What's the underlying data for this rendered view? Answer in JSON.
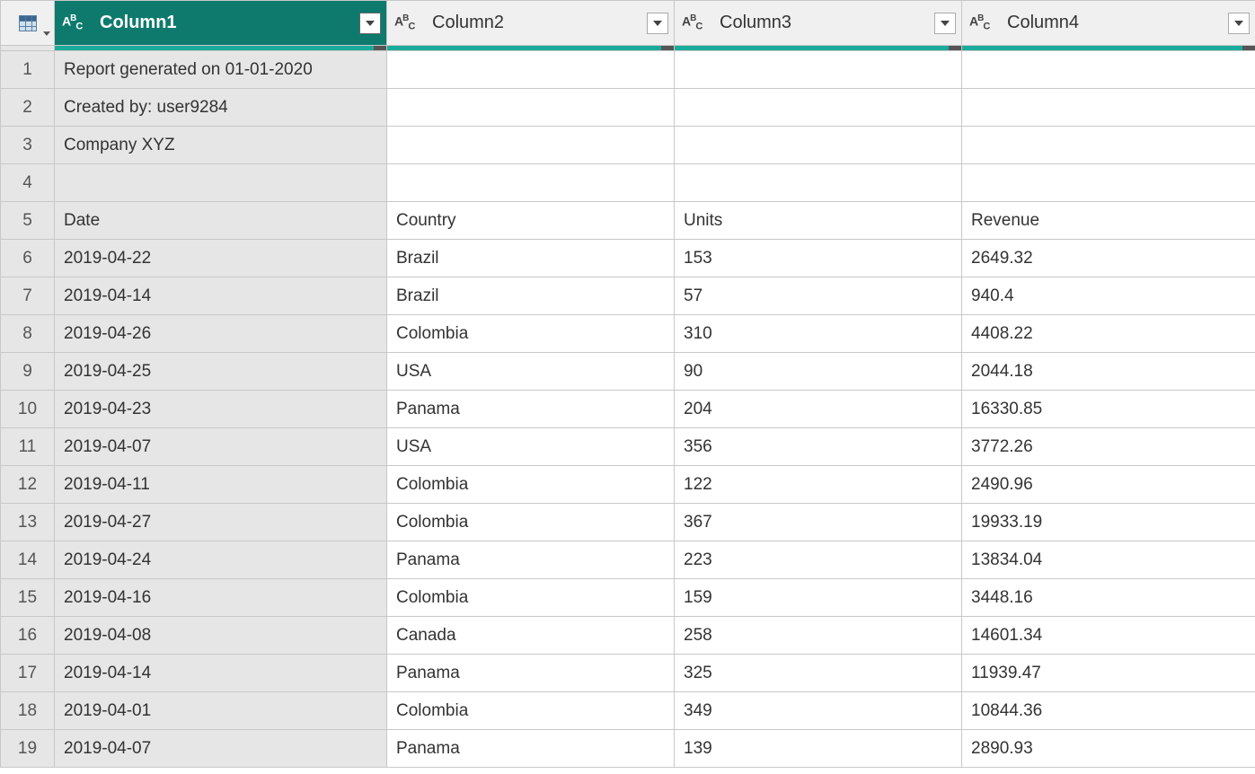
{
  "columns": [
    {
      "name": "Column1",
      "type_label": "ABC",
      "selected": true
    },
    {
      "name": "Column2",
      "type_label": "ABC",
      "selected": false
    },
    {
      "name": "Column3",
      "type_label": "ABC",
      "selected": false
    },
    {
      "name": "Column4",
      "type_label": "ABC",
      "selected": false
    }
  ],
  "row_numbers": [
    "1",
    "2",
    "3",
    "4",
    "5",
    "6",
    "7",
    "8",
    "9",
    "10",
    "11",
    "12",
    "13",
    "14",
    "15",
    "16",
    "17",
    "18",
    "19"
  ],
  "rows": [
    [
      "Report generated on 01-01-2020",
      "",
      "",
      ""
    ],
    [
      "Created by: user9284",
      "",
      "",
      ""
    ],
    [
      "Company XYZ",
      "",
      "",
      ""
    ],
    [
      "",
      "",
      "",
      ""
    ],
    [
      "Date",
      "Country",
      "Units",
      "Revenue"
    ],
    [
      "2019-04-22",
      "Brazil",
      "153",
      "2649.32"
    ],
    [
      "2019-04-14",
      "Brazil",
      "57",
      "940.4"
    ],
    [
      "2019-04-26",
      "Colombia",
      "310",
      "4408.22"
    ],
    [
      "2019-04-25",
      "USA",
      "90",
      "2044.18"
    ],
    [
      "2019-04-23",
      "Panama",
      "204",
      "16330.85"
    ],
    [
      "2019-04-07",
      "USA",
      "356",
      "3772.26"
    ],
    [
      "2019-04-11",
      "Colombia",
      "122",
      "2490.96"
    ],
    [
      "2019-04-27",
      "Colombia",
      "367",
      "19933.19"
    ],
    [
      "2019-04-24",
      "Panama",
      "223",
      "13834.04"
    ],
    [
      "2019-04-16",
      "Colombia",
      "159",
      "3448.16"
    ],
    [
      "2019-04-08",
      "Canada",
      "258",
      "14601.34"
    ],
    [
      "2019-04-14",
      "Panama",
      "325",
      "11939.47"
    ],
    [
      "2019-04-01",
      "Colombia",
      "349",
      "10844.36"
    ],
    [
      "2019-04-07",
      "Panama",
      "139",
      "2890.93"
    ]
  ]
}
